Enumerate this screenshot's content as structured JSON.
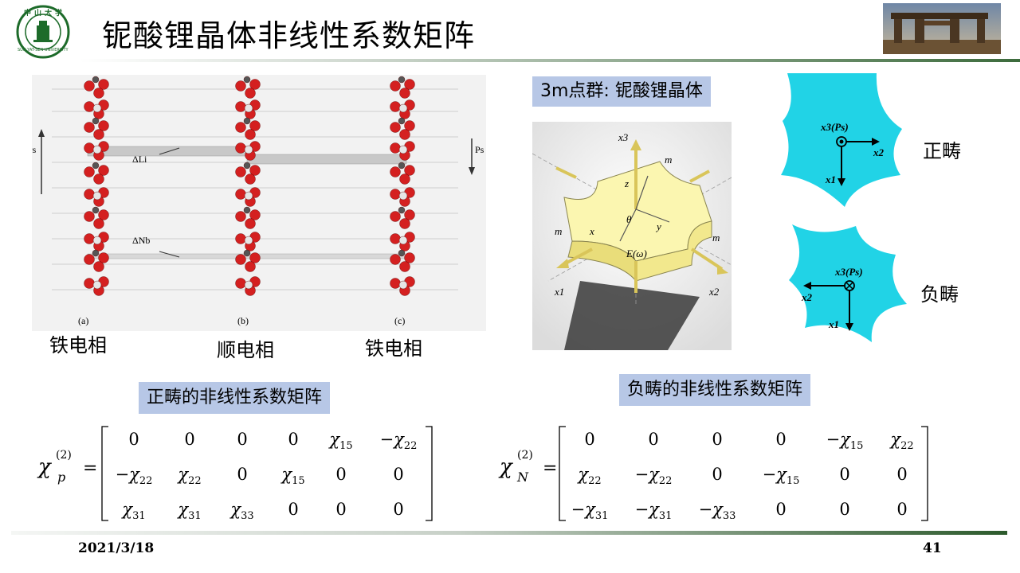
{
  "header": {
    "title": "铌酸锂晶体非线性系数矩阵",
    "logo_text": "中山大学",
    "logo_ring": "SUN YAT-SEN UNIVERSITY"
  },
  "structure_figure": {
    "ps_left": "Ps",
    "ps_right": "Ps",
    "delta_li": "ΔLi",
    "delta_nb": "ΔNb",
    "sub_labels": [
      "(a)",
      "(b)",
      "(c)"
    ],
    "phase_labels": [
      "铁电相",
      "顺电相",
      "铁电相"
    ]
  },
  "point_group": {
    "label": "3m点群: 铌酸锂晶体",
    "axis_labels": {
      "x3": "x3",
      "x1": "x1",
      "x2": "x2",
      "z": "z",
      "x": "x",
      "y": "y",
      "m": "m",
      "theta": "θ",
      "field": "E(ω)"
    }
  },
  "domains": {
    "positive": {
      "label": "正畴",
      "axis3": "x3(Ps)",
      "axis2": "x2",
      "axis1": "x1"
    },
    "negative": {
      "label": "负畴",
      "axis3": "x3(Ps)",
      "axis2": "x2",
      "axis1": "x1"
    }
  },
  "matrices": {
    "positive": {
      "title": "正畴的非线性系数矩阵",
      "lhs_symbol": "χ",
      "lhs_sub": "p",
      "lhs_sup": "(2)",
      "equals": "=",
      "rows": [
        [
          "0",
          "0",
          "0",
          "0",
          "χ15",
          "−χ22"
        ],
        [
          "−χ22",
          "χ22",
          "0",
          "χ15",
          "0",
          "0"
        ],
        [
          "χ31",
          "χ31",
          "χ33",
          "0",
          "0",
          "0"
        ]
      ]
    },
    "negative": {
      "title": "负畴的非线性系数矩阵",
      "lhs_symbol": "χ",
      "lhs_sub": "N",
      "lhs_sup": "(2)",
      "equals": "=",
      "rows": [
        [
          "0",
          "0",
          "0",
          "0",
          "−χ15",
          "χ22"
        ],
        [
          "χ22",
          "−χ22",
          "0",
          "−χ15",
          "0",
          "0"
        ],
        [
          "−χ31",
          "−χ31",
          "−χ33",
          "0",
          "0",
          "0"
        ]
      ]
    }
  },
  "footer": {
    "date": "2021/3/18",
    "page": "41"
  },
  "colors": {
    "domain_fill": "#21d3e6",
    "label_box": "#b7c7e6",
    "atom_red": "#d42020",
    "accent_green": "#2c5a2c"
  }
}
